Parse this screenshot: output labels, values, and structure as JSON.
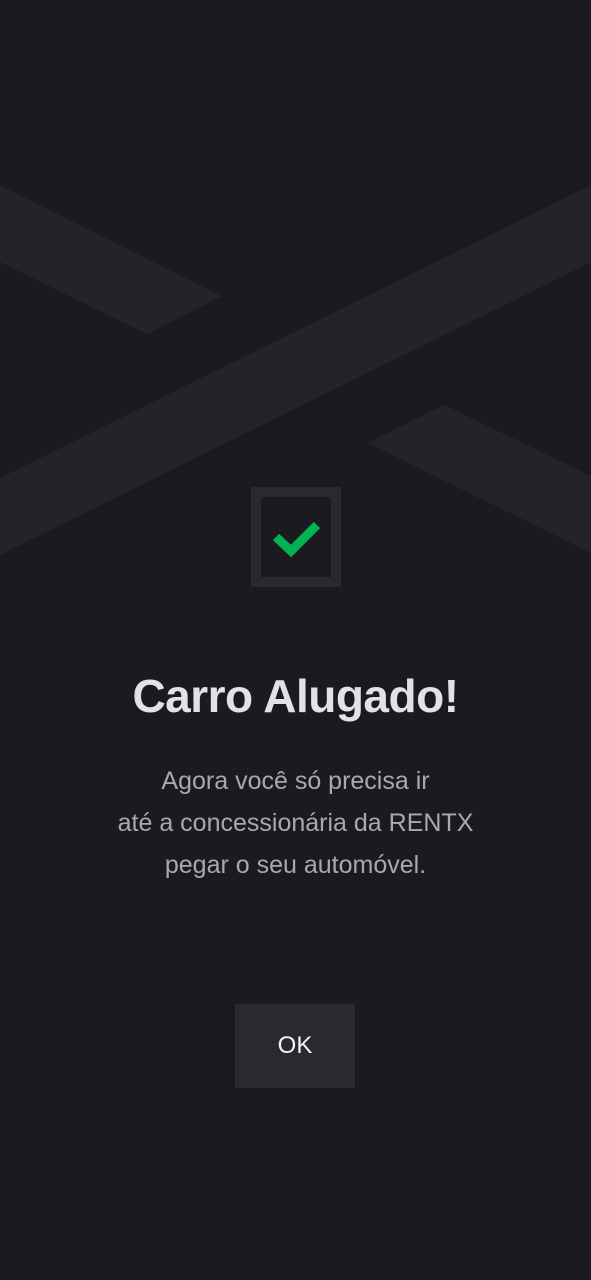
{
  "background": {
    "logo_icon": "rentx-x-logo-icon",
    "logo_color": "#232328"
  },
  "success": {
    "icon": "checkmark-icon",
    "check_color": "#03b252",
    "frame_color": "#29292e"
  },
  "title": "Carro Alugado!",
  "message": {
    "line1": "Agora você só precisa ir",
    "line2": "até a concessionária da RENTX",
    "line3": "pegar o seu automóvel."
  },
  "button": {
    "label": "OK"
  },
  "colors": {
    "background": "#1b1b1f",
    "title": "#e1e1e6",
    "text": "#a8a8b3",
    "button_bg": "#29292e"
  }
}
